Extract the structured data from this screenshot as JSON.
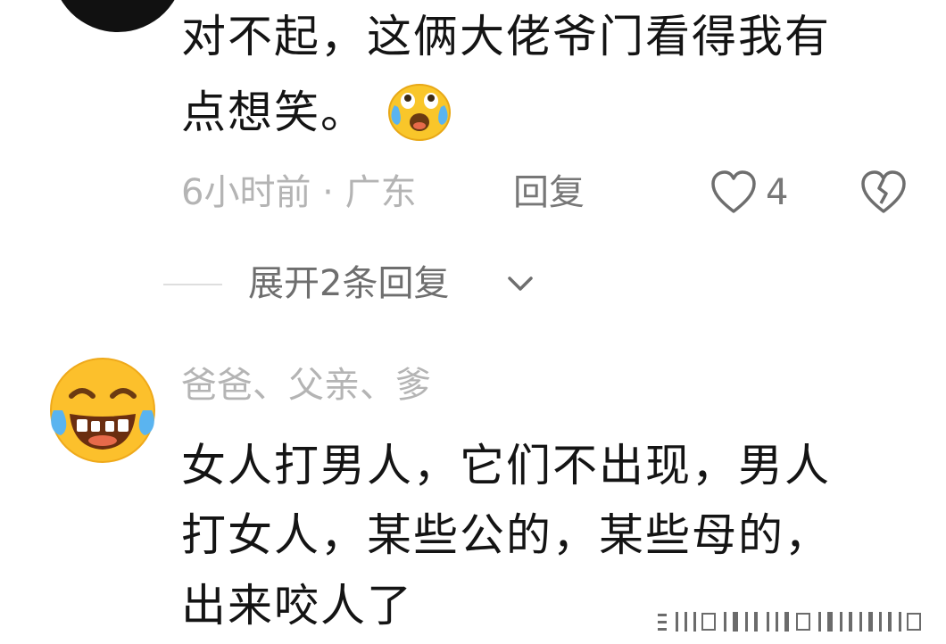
{
  "comment1": {
    "line1": "对不起，这俩大佬爷门看得我有",
    "line2": "点想笑。",
    "inline_emoji": "cry-laugh-emoji",
    "meta_time": "6小时前 · 广东",
    "reply_label": "回复",
    "like_count": "4"
  },
  "replies_expand": {
    "label": "展开2条回复"
  },
  "comment2": {
    "username": "爸爸、父亲、爹",
    "line1": "女人打男人，它们不出现，男人",
    "line2": "打女人，某些公的，某些母的，",
    "line3": "出来咬人了"
  },
  "colors": {
    "primary_text": "#141414",
    "meta_text": "#b4b4b4",
    "action_text": "#777777"
  }
}
